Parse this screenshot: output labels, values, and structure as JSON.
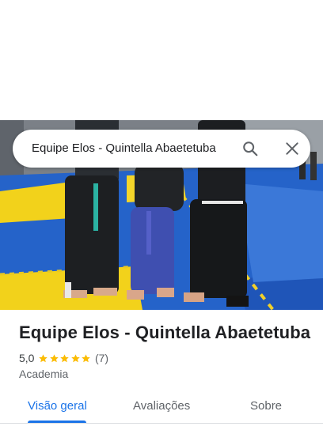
{
  "colors": {
    "accent": "#1a73e8",
    "star": "#fbbc04",
    "text_primary": "#202124",
    "text_secondary": "#5f6368"
  },
  "search": {
    "query": "Equipe Elos - Quintella Abaetetuba",
    "search_icon": "search-icon",
    "close_icon": "close-icon"
  },
  "place": {
    "name": "Equipe Elos - Quintella Abaetetuba",
    "rating": "5,0",
    "stars": 5,
    "review_count": "(7)",
    "category": "Academia"
  },
  "tabs": [
    {
      "label": "Visão geral",
      "active": true
    },
    {
      "label": "Avaliações",
      "active": false
    },
    {
      "label": "Sobre",
      "active": false
    }
  ]
}
